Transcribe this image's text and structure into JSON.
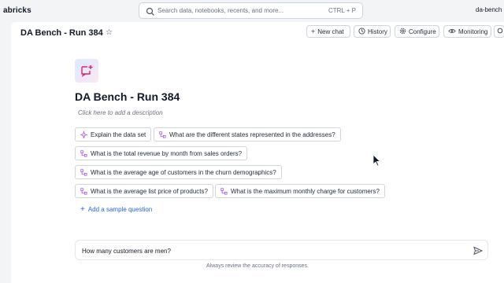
{
  "topbar": {
    "brand": "abricks",
    "search_placeholder": "Search data, notebooks, recents, and more...",
    "shortcut": "CTRL + P",
    "workspace": "da-bench"
  },
  "header": {
    "title": "DA Bench - Run 384",
    "buttons": {
      "new_chat": "New chat",
      "history": "History",
      "configure": "Configure",
      "monitoring": "Monitoring"
    }
  },
  "space": {
    "title": "DA Bench - Run 384",
    "description_placeholder": "Click here to add a description"
  },
  "sample_questions": [
    "Explain the data set",
    "What are the different states represented in the addresses?",
    "What is the total revenue by month from sales orders?",
    "What is the average age of customers in the churn demographics?",
    "What is the average list price of products?",
    "What is the maximum monthly charge for customers?"
  ],
  "add_sample_label": "Add a sample question",
  "composer": {
    "value": "How many customers are men?"
  },
  "footer_note": "Always review the accuracy of responses.",
  "colors": {
    "accent": "#2563eb",
    "chip_icon": "#a855f7",
    "avatar_icon": "#db2777"
  }
}
